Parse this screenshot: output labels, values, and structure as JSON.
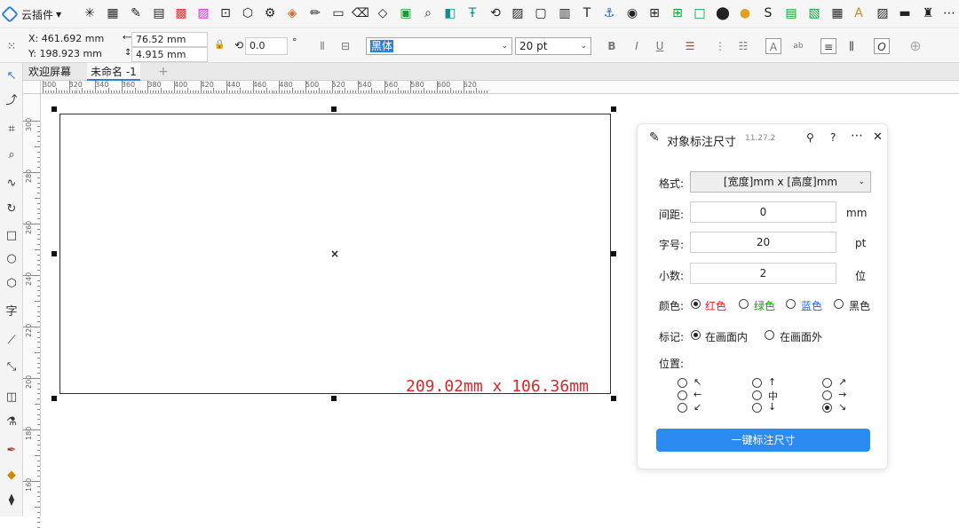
{
  "app": {
    "plugin_menu": "云插件",
    "toolbar_icons": [
      "sparkle-icon",
      "qr-icon",
      "pen-icon",
      "page-icon",
      "color-grid-icon",
      "palette-icon",
      "frame-icon",
      "shape-icon",
      "settings-icon",
      "shield-icon",
      "pencil-icon",
      "note-icon",
      "eraser-icon",
      "layer-icon",
      "image-icon",
      "search-icon",
      "bookmark-icon",
      "text-icon",
      "transform-icon",
      "picture-icon",
      "window-icon",
      "text-t-icon",
      "stamp-icon",
      "grid-icon",
      "table-icon",
      "square-icon",
      "target-icon",
      "coin-icon",
      "s-icon",
      "chart-icon",
      "font-a-icon",
      "gallery-icon",
      "clapper-icon"
    ]
  },
  "propbar": {
    "x": "X: 461.692 mm",
    "y": "Y: 198.923 mm",
    "width": "76.52 mm",
    "height": "4.915 mm",
    "rotation": "0.0",
    "degree": "°",
    "font_name": "黑体",
    "font_size": "20 pt"
  },
  "tabs": {
    "welcome": "欢迎屏幕",
    "doc": "未命名 -1",
    "add": "+"
  },
  "ruler": {
    "h_ticks": [
      "300",
      "320",
      "340",
      "360",
      "380",
      "400",
      "420",
      "440",
      "460",
      "480",
      "500",
      "520",
      "540",
      "560",
      "580",
      "600",
      "620"
    ],
    "v_ticks": [
      "300",
      "280",
      "260",
      "240",
      "220",
      "200",
      "180",
      "160"
    ]
  },
  "canvas": {
    "dimension_text": "209.02mm x 106.36mm",
    "center_mark": "×"
  },
  "panel": {
    "title": "对象标注尺寸",
    "version": "11.27.2",
    "format_label": "格式:",
    "format_value": "[宽度]mm x [高度]mm",
    "spacing_label": "间距:",
    "spacing_value": "0",
    "spacing_unit": "mm",
    "fontsize_label": "字号:",
    "fontsize_value": "20",
    "fontsize_unit": "pt",
    "decimal_label": "小数:",
    "decimal_value": "2",
    "decimal_unit": "位",
    "color_label": "颜色:",
    "colors": [
      {
        "label": "红色",
        "color": "#e02020",
        "selected": true
      },
      {
        "label": "绿色",
        "color": "#1a9a1a",
        "selected": false
      },
      {
        "label": "蓝色",
        "color": "#2a62d8",
        "selected": false
      },
      {
        "label": "黑色",
        "color": "#222222",
        "selected": false
      }
    ],
    "mark_label": "标记:",
    "mark_inside": "在画面内",
    "mark_outside": "在画面外",
    "position_label": "位置:",
    "positions": [
      {
        "arrow": "↖",
        "selected": false
      },
      {
        "arrow": "↑",
        "selected": false
      },
      {
        "arrow": "↗",
        "selected": false
      },
      {
        "arrow": "←",
        "selected": false
      },
      {
        "arrow": "中",
        "selected": false
      },
      {
        "arrow": "→",
        "selected": false
      },
      {
        "arrow": "↙",
        "selected": false
      },
      {
        "arrow": "↓",
        "selected": false
      },
      {
        "arrow": "↘",
        "selected": true
      }
    ],
    "run_button": "一键标注尺寸"
  }
}
